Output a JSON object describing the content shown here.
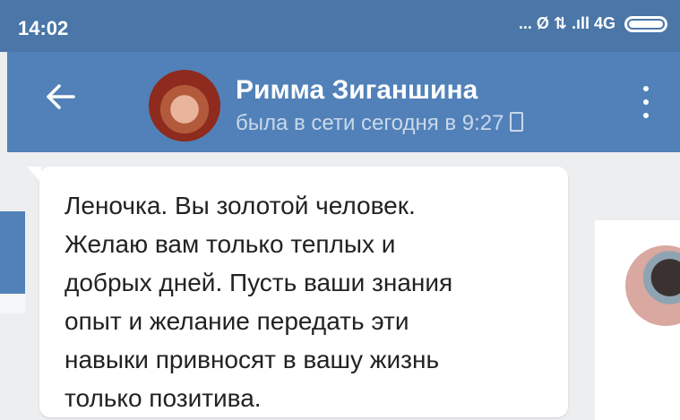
{
  "status_bar": {
    "time": "14:02",
    "indicators": "... Ø ⇅ .ıll 4G",
    "icons": [
      "signal-icon",
      "network-4g-icon",
      "battery-icon"
    ]
  },
  "header": {
    "contact_name": "Римма Зиганшина",
    "contact_status": "была в сети сегодня в 9:27",
    "icons": [
      "back-arrow-icon",
      "avatar",
      "phone-icon",
      "more-vert-icon"
    ]
  },
  "message": {
    "text": "Леночка. Вы золотой человек.\nЖелаю вам только теплых и\nдобрых дней. Пусть ваши знания\nопыт и желание передать эти\nнавыки привносят в вашу жизнь\nтолько позитива."
  },
  "colors": {
    "status_bar": "#4a76a8",
    "app_bar": "#5181b8",
    "background": "#edeef0",
    "bubble": "#ffffff"
  }
}
